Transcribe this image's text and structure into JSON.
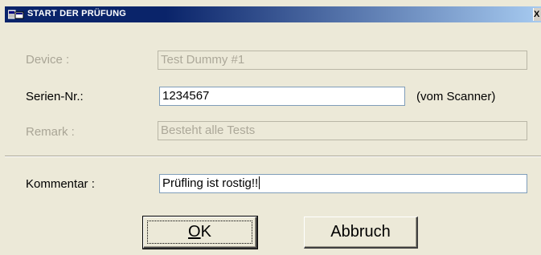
{
  "window": {
    "title": "START DER PRÜFUNG",
    "close_glyph": "X"
  },
  "form": {
    "device": {
      "label": "Device :",
      "value": "Test Dummy #1"
    },
    "serial": {
      "label": "Serien-Nr.:",
      "value": "1234567",
      "hint": "(vom Scanner)"
    },
    "remark": {
      "label": "Remark :",
      "value": "Besteht alle Tests"
    },
    "comment": {
      "label": "Kommentar :",
      "value": "Prüfling ist rostig!!"
    }
  },
  "buttons": {
    "ok": {
      "accel": "O",
      "rest": "K"
    },
    "cancel": {
      "label": "Abbruch"
    }
  },
  "icons": {
    "title_icon": "app-window-icon",
    "close": "close-icon"
  },
  "colors": {
    "title_start": "#0a246a",
    "title_end": "#a6caf0",
    "dialog_bg": "#ece9d8",
    "disabled_text": "#aca899"
  }
}
